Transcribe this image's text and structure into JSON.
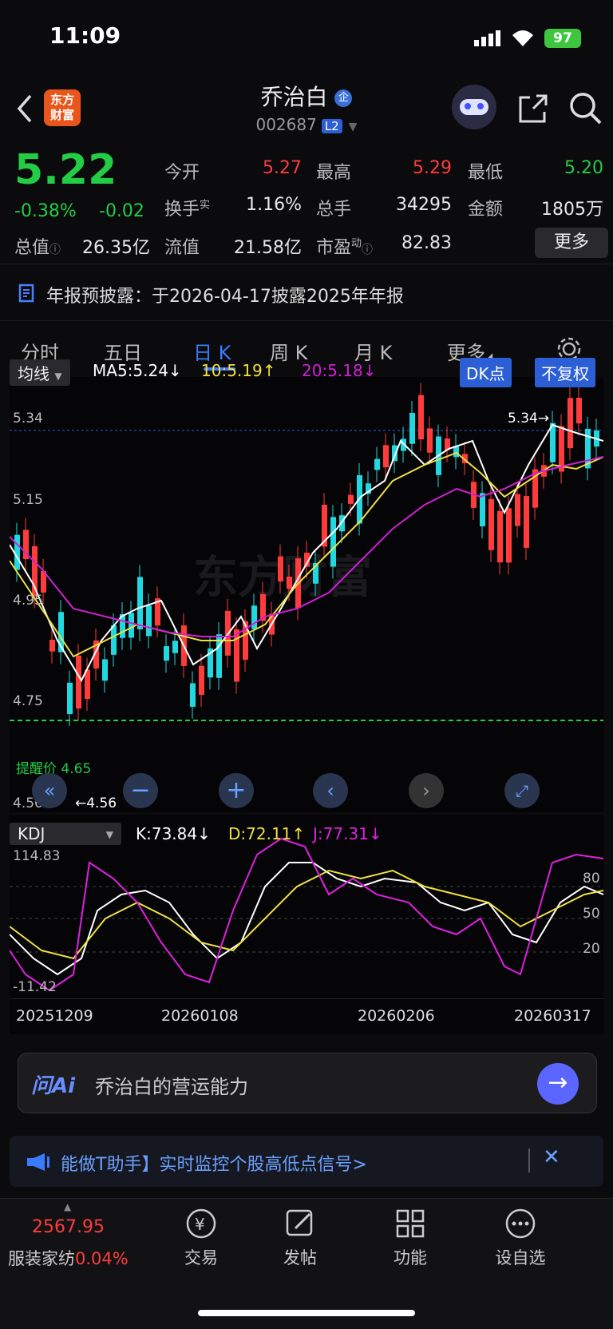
{
  "status": {
    "time": "11:09",
    "battery": "97"
  },
  "header": {
    "logo_line1": "东方",
    "logo_line2": "财富",
    "title": "乔治白",
    "badge": "企",
    "code": "002687",
    "level": "L2"
  },
  "quote": {
    "price": "5.22",
    "pct": "-0.38%",
    "chg": "-0.02",
    "open_label": "今开",
    "open": "5.27",
    "high_label": "最高",
    "high": "5.29",
    "low_label": "最低",
    "low": "5.20",
    "turnover_label": "换手",
    "turnover_sup": "实",
    "turnover": "1.16%",
    "vol_label": "总手",
    "vol": "34295",
    "amt_label": "金额",
    "amt": "1805万",
    "cap_label": "总值",
    "cap": "26.35亿",
    "float_label": "流值",
    "float": "21.58亿",
    "pe_label": "市盈",
    "pe_sup": "动",
    "pe": "82.83",
    "more": "更多"
  },
  "notice": "年报预披露：于2026-04-17披露2025年年报",
  "tabs": [
    "分时",
    "五日",
    "日 K",
    "周 K",
    "月 K",
    "更多"
  ],
  "kline": {
    "indicator": "均线",
    "ma5": "MA5:5.24↓",
    "ma10": "10:5.19↑",
    "ma20": "20:5.18↓",
    "dk_btn": "DK点",
    "fq_btn": "不复权",
    "y_top": "5.34",
    "y_mid": "5.15",
    "y_low1": "4.95",
    "y_low2": "4.75",
    "y_bottom": "4.56",
    "max_label": "5.34→",
    "min_label": "←4.56",
    "watermark": "东方财富",
    "remind": "提醒价 4.65"
  },
  "kdj": {
    "indicator": "KDJ",
    "k": "K:73.84↓",
    "d": "D:72.11↑",
    "j": "J:77.31↓",
    "top": "114.83",
    "bottom": "-11.42",
    "l80": "80",
    "l50": "50",
    "l20": "20"
  },
  "dates": [
    "20251209",
    "20260108",
    "20260206",
    "20260317"
  ],
  "ai": {
    "logo": "问Ai",
    "text": "乔治白的营运能力"
  },
  "promo": "能做T助手】实时监控个股高低点信号>",
  "bottom_nav": {
    "index_value": "2567.95",
    "index_name": "服装家纺",
    "index_pct": "0.04%",
    "items": [
      "交易",
      "发帖",
      "功能",
      "设自选"
    ]
  },
  "colors": {
    "up": "#ff3b3b",
    "down": "#22cc44",
    "ma5": "#ffffff",
    "ma10": "#f0e040",
    "ma20": "#d020d0",
    "accent": "#3a7bff"
  }
}
